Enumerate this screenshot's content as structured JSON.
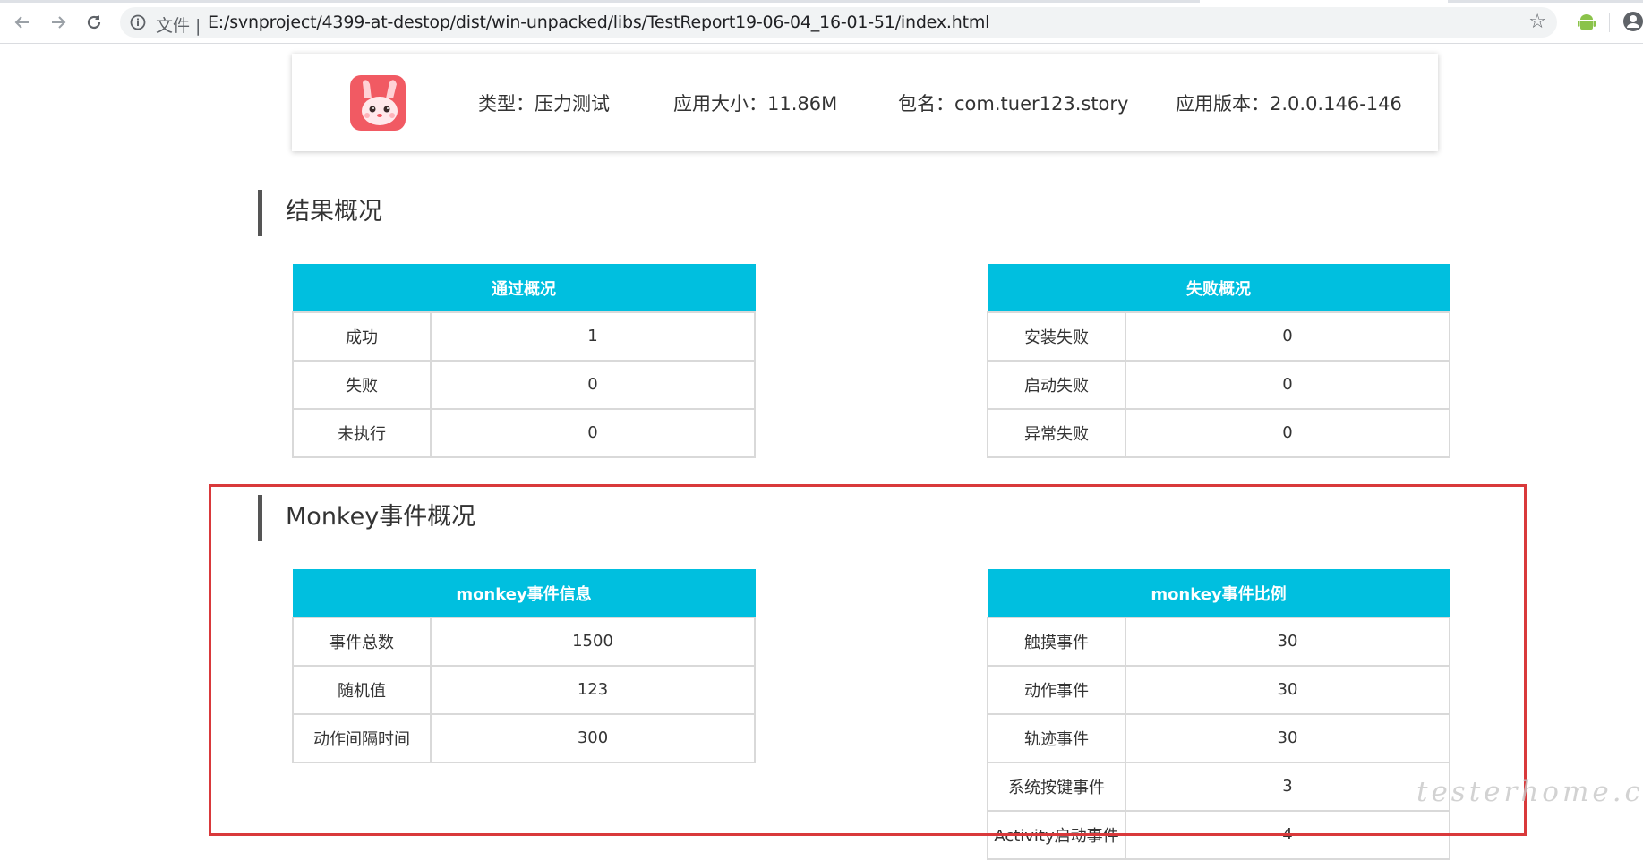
{
  "browser": {
    "scheme_label": "文件 |",
    "url": "E:/svnproject/4399-at-destop/dist/win-unpacked/libs/TestReport19-06-04_16-01-51/index.html",
    "icons": [
      "back-arrow-icon",
      "forward-arrow-icon",
      "reload-icon",
      "info-icon",
      "star-icon",
      "android-icon",
      "profile-icon"
    ]
  },
  "app_info": {
    "type": "类型：压力测试",
    "size": "应用大小：11.86M",
    "package": "包名：com.tuer123.story",
    "version": "应用版本：2.0.0.146-146",
    "icon": "rabbit-app-icon"
  },
  "results_section": {
    "title": "结果概况",
    "pass_table": {
      "header": "通过概况",
      "rows": [
        {
          "label": "成功",
          "value": "1"
        },
        {
          "label": "失败",
          "value": "0"
        },
        {
          "label": "未执行",
          "value": "0"
        }
      ]
    },
    "fail_table": {
      "header": "失败概况",
      "rows": [
        {
          "label": "安装失败",
          "value": "0"
        },
        {
          "label": "启动失败",
          "value": "0"
        },
        {
          "label": "异常失败",
          "value": "0"
        }
      ]
    }
  },
  "monkey_section": {
    "title": "Monkey事件概况",
    "info_table": {
      "header": "monkey事件信息",
      "rows": [
        {
          "label": "事件总数",
          "value": "1500"
        },
        {
          "label": "随机值",
          "value": "123"
        },
        {
          "label": "动作间隔时间",
          "value": "300"
        }
      ]
    },
    "ratio_table": {
      "header": "monkey事件比例",
      "rows": [
        {
          "label": "触摸事件",
          "value": "30"
        },
        {
          "label": "动作事件",
          "value": "30"
        },
        {
          "label": "轨迹事件",
          "value": "30"
        },
        {
          "label": "系统按键事件",
          "value": "3"
        },
        {
          "label": "Activity启动事件",
          "value": "4"
        }
      ]
    }
  },
  "watermark": "testerhome.com",
  "colors": {
    "table_header": "#00bfdf",
    "highlight": "#d9393b",
    "section_bar": "#555555"
  }
}
